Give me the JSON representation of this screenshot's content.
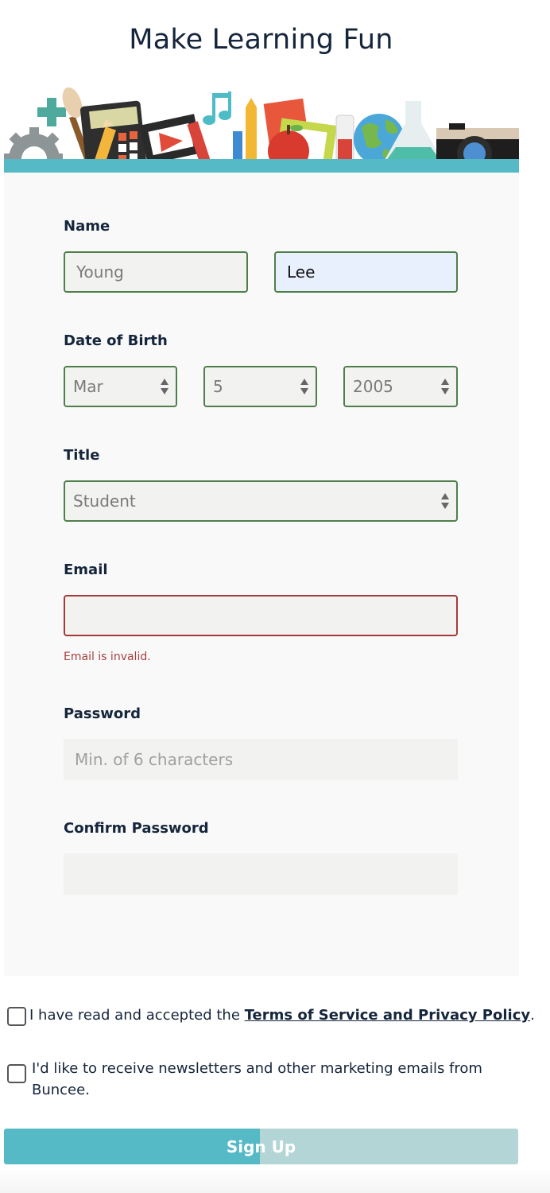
{
  "title": "Make Learning Fun",
  "colors": {
    "accent": "#56b9c6",
    "field_border": "#4e7f4a",
    "error": "#a43a3a",
    "text": "#15253b"
  },
  "form": {
    "name": {
      "label": "Name",
      "first_value": "Young",
      "last_value": "Lee"
    },
    "dob": {
      "label": "Date of Birth",
      "month": "Mar",
      "day": "5",
      "year": "2005"
    },
    "title": {
      "label": "Title",
      "value": "Student"
    },
    "email": {
      "label": "Email",
      "value": "",
      "error": "Email is invalid."
    },
    "password": {
      "label": "Password",
      "placeholder": "Min. of 6 characters"
    },
    "confirm_password": {
      "label": "Confirm Password",
      "placeholder": ""
    }
  },
  "terms": {
    "prefix": "I have read and accepted the ",
    "link": "Terms of Service and Privacy Policy",
    "suffix": ".",
    "checked": false
  },
  "newsletter": {
    "line1": "I'd like to receive newsletters and other marketing emails from",
    "line2": "Buncee.",
    "checked": false
  },
  "signup": {
    "label": "Sign Up",
    "progress": 0.5
  },
  "banner_icons": [
    "gear-icon",
    "plus-icon",
    "paintbrush-icon",
    "calculator-icon",
    "pencil-icon",
    "film-strip-icon",
    "music-note-icon",
    "crayons-icon",
    "apple-icon",
    "picture-frame-icon",
    "test-tube-icon",
    "globe-icon",
    "flask-icon",
    "camera-icon"
  ]
}
